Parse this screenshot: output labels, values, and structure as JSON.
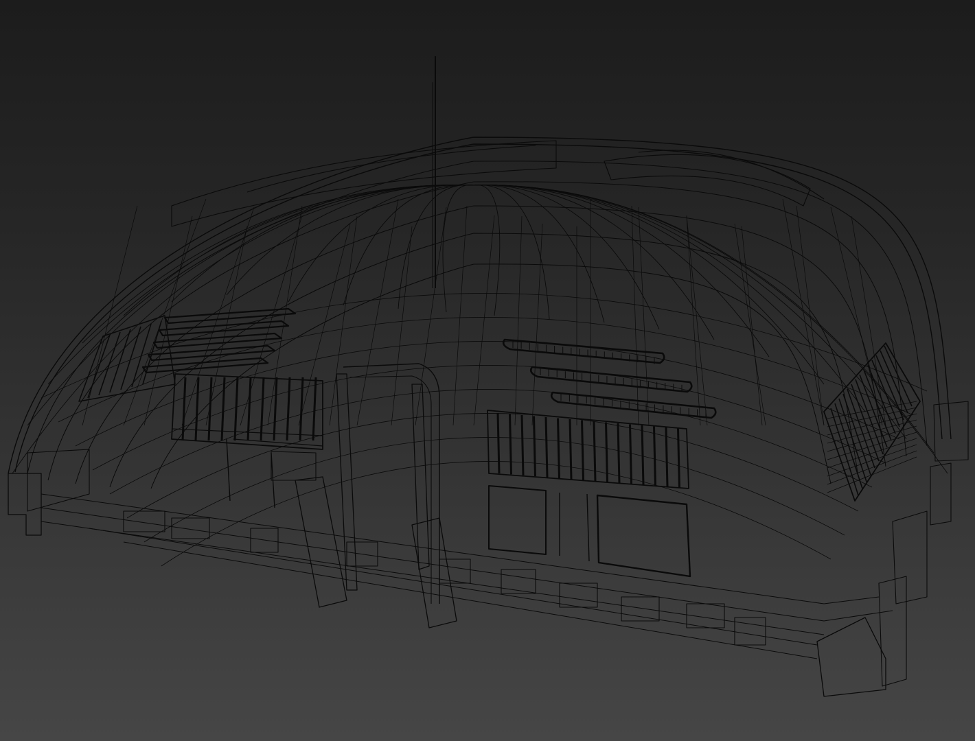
{
  "viewport": {
    "view_mode": "wireframe",
    "subject": "dome-hangar-model",
    "background_top": "#1c1c1c",
    "background_bottom": "#464646",
    "wire_color": "#0a0a0a"
  }
}
